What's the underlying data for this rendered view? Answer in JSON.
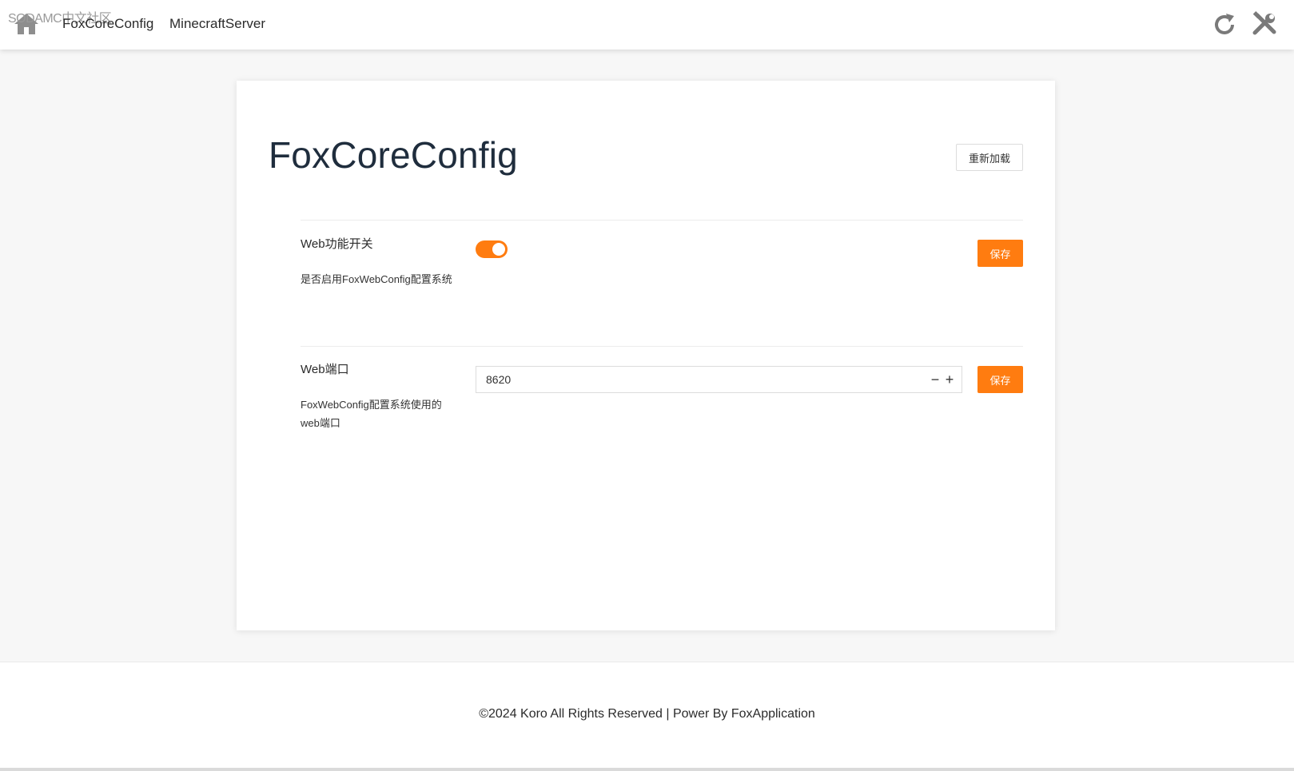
{
  "watermark": "SODAMC中文社区",
  "nav": {
    "home_icon": "home-icon",
    "links": [
      "FoxCoreConfig",
      "MinecraftServer"
    ],
    "right_icons": [
      "reload-icon",
      "tools-icon"
    ]
  },
  "card": {
    "title": "FoxCoreConfig",
    "reload_label": "重新加载",
    "fields": [
      {
        "label": "Web功能开关",
        "description": "是否启用FoxWebConfig配置系统",
        "type": "toggle",
        "value": true,
        "save_label": "保存"
      },
      {
        "label": "Web端口",
        "description": "FoxWebConfig配置系统使用的web端口",
        "type": "number",
        "value": "8620",
        "minus": "−",
        "plus": "+",
        "save_label": "保存"
      }
    ]
  },
  "footer": {
    "text": "©2024 Koro All Rights Reserved | Power By FoxApplication"
  },
  "colors": {
    "accent": "#ff7c10",
    "title": "#1f2d3d",
    "background": "#f7f7f7"
  }
}
